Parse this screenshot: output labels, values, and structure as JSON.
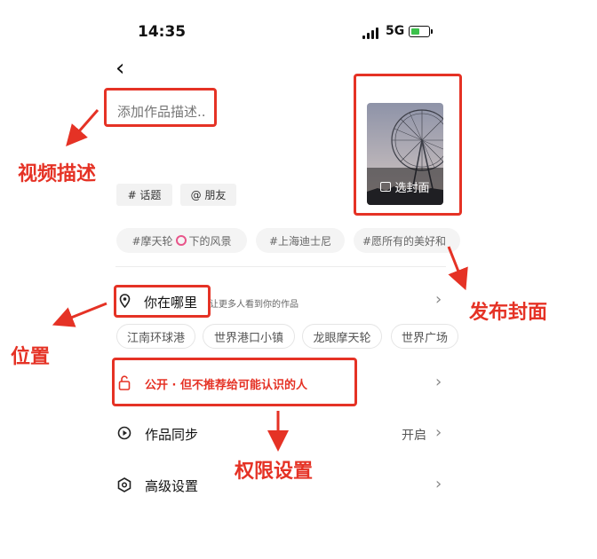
{
  "status": {
    "time": "14:35",
    "network": "5G"
  },
  "description": {
    "placeholder": "添加作品描述.."
  },
  "cover": {
    "label": "选封面"
  },
  "tags": {
    "topic": "# 话题",
    "friend": "@ 朋友"
  },
  "suggestions": [
    "#摩天轮",
    "下的风景",
    "#上海迪士尼",
    "#愿所有的美好和"
  ],
  "location": {
    "title": "你在哪里",
    "hint": "让更多人看到你的作品",
    "places": [
      "江南环球港",
      "世界港口小镇",
      "龙眼摩天轮",
      "世界广场"
    ]
  },
  "privacy": {
    "label": "公开 · 但不推荐给可能认识的人"
  },
  "sync": {
    "label": "作品同步",
    "value": "开启"
  },
  "advanced": {
    "label": "高级设置"
  },
  "annotations": {
    "desc": "视频描述",
    "location": "位置",
    "privacy": "权限设置",
    "cover": "发布封面"
  },
  "colors": {
    "annotation": "#e53225"
  }
}
